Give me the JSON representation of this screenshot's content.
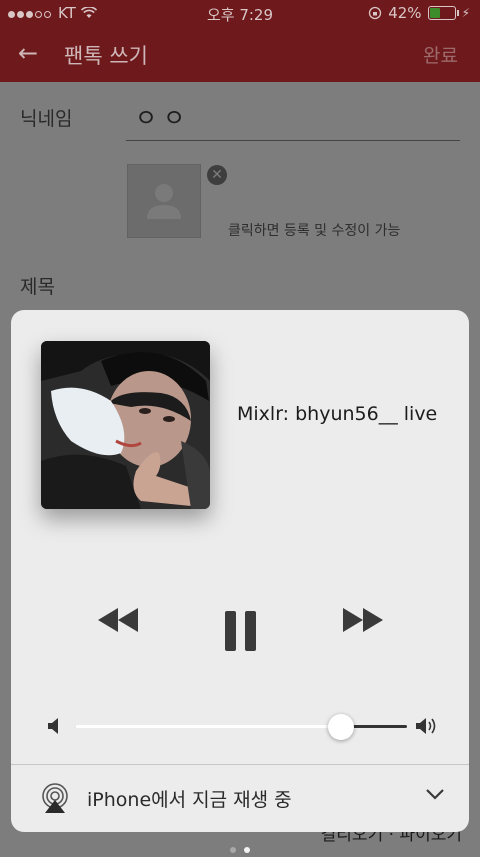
{
  "status_bar": {
    "carrier": "KT",
    "time": "오후 7:29",
    "battery_percent": "42%",
    "battery_level": 0.42
  },
  "app_bar": {
    "title": "팬톡 쓰기",
    "done_label": "완료"
  },
  "form": {
    "nickname_label": "닉네임",
    "nickname_value": "ㅇㅇ",
    "photo_hint": "클릭하면 등록 및 수정이 가능",
    "subject_label": "제목",
    "bottom_text": "길리오기 · 파이오기"
  },
  "now_playing": {
    "title": "Mixlr: bhyun56__ live",
    "volume_level": 0.8,
    "airplay_label": "iPhone에서 지금 재생 중"
  },
  "colors": {
    "accent": "#c62828",
    "card": "#ececec"
  },
  "page_indicator": {
    "count": 2,
    "active_index": 1
  }
}
